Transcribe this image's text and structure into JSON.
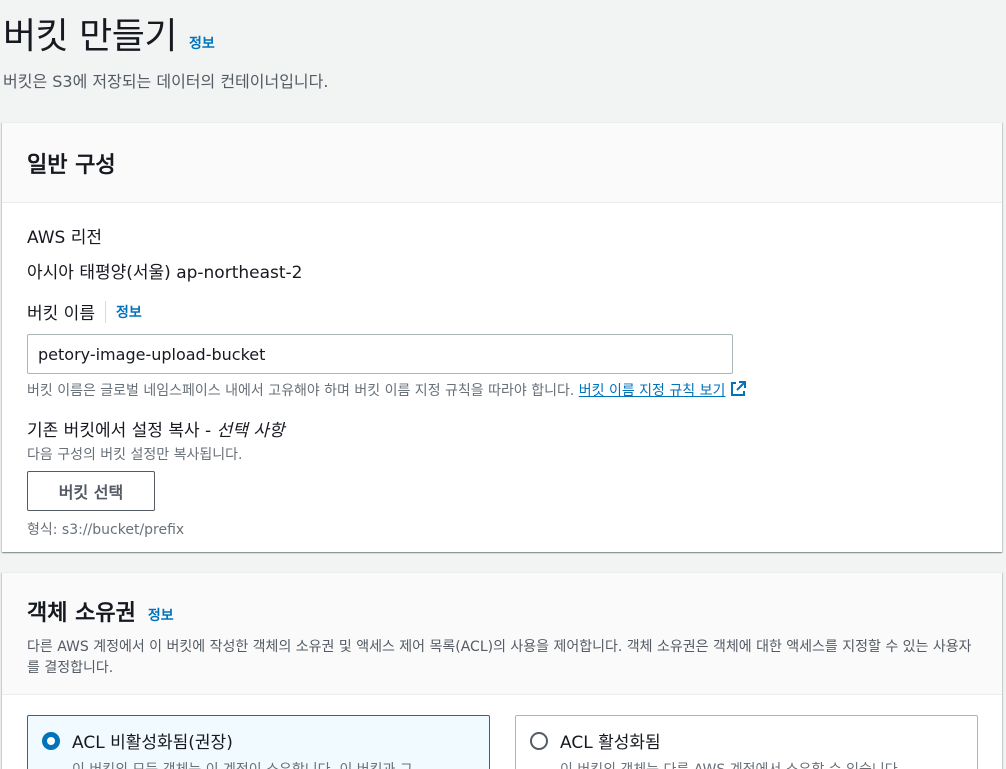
{
  "header": {
    "title": "버킷 만들기",
    "info": "정보",
    "description": "버킷은 S3에 저장되는 데이터의 컨테이너입니다."
  },
  "general": {
    "title": "일반 구성",
    "region_label": "AWS 리전",
    "region_value": "아시아 태평양(서울) ap-northeast-2",
    "bucket_name_label": "버킷 이름",
    "bucket_name_info": "정보",
    "bucket_name_value": "petory-image-upload-bucket",
    "bucket_name_hint": "버킷 이름은 글로벌 네임스페이스 내에서 고유해야 하며 버킷 이름 지정 규칙을 따라야 합니다.",
    "bucket_name_rules_link": "버킷 이름 지정 규칙 보기",
    "copy_label": "기존 버킷에서 설정 복사 - ",
    "copy_optional": "선택 사항",
    "copy_desc": "다음 구성의 버킷 설정만 복사됩니다.",
    "choose_bucket_button": "버킷 선택",
    "format_hint": "형식: s3://bucket/prefix"
  },
  "ownership": {
    "title": "객체 소유권",
    "info": "정보",
    "description": "다른 AWS 계정에서 이 버킷에 작성한 객체의 소유권 및 액세스 제어 목록(ACL)의 사용을 제어합니다. 객체 소유권은 객체에 대한 액세스를 지정할 수 있는 사용자를 결정합니다.",
    "options": [
      {
        "label": "ACL 비활성화됨(권장)",
        "desc": "이 버킷의 모든 객체는 이 계정이 소유합니다. 이 버킷과 그",
        "selected": true
      },
      {
        "label": "ACL 활성화됨",
        "desc": "이 버킷의 객체는 다른 AWS 계정에서 소유할 수 있습니다.",
        "selected": false
      }
    ]
  },
  "colors": {
    "link": "#0073bb",
    "background": "#f2f3f3",
    "panel_header": "#fafafa"
  }
}
